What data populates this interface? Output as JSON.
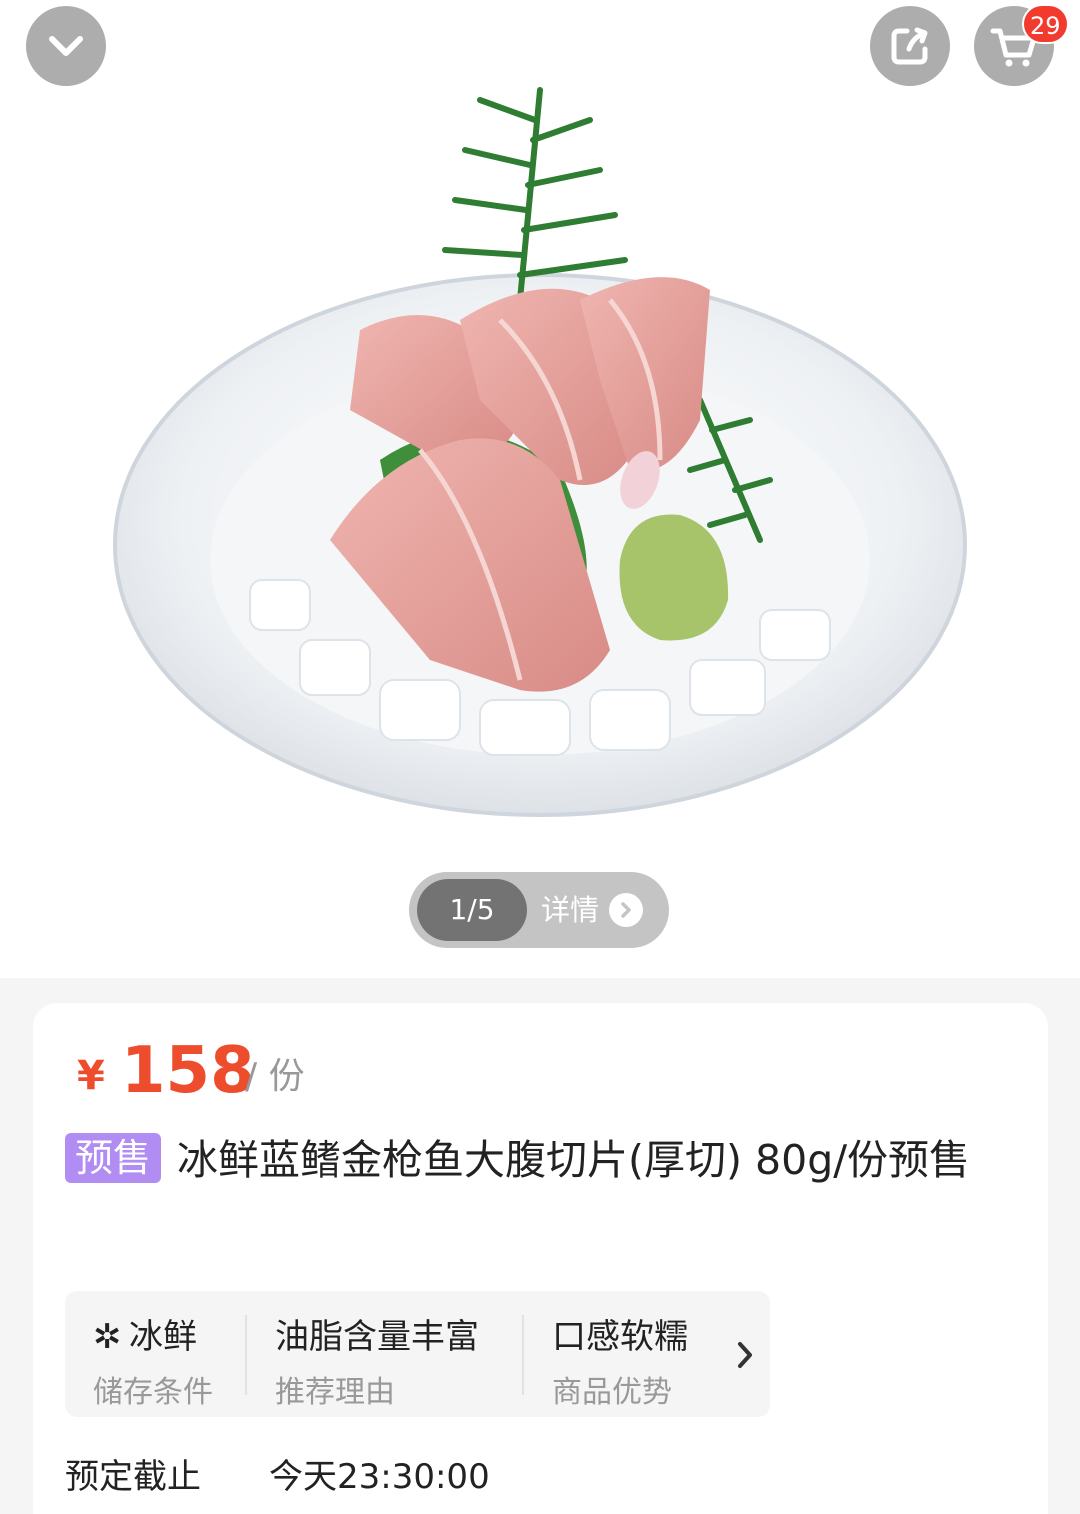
{
  "header": {
    "collapse_icon": "chevron-down-icon",
    "share_icon": "share-icon",
    "cart_icon": "cart-icon",
    "cart_count": "29"
  },
  "gallery": {
    "page_indicator": "1/5",
    "detail_label": "详情"
  },
  "product": {
    "currency": "¥",
    "price": "158",
    "unit": "/ 份",
    "tag": "预售",
    "title": "冰鲜蓝鳍金枪鱼大腹切片(厚切) 80g/份预售",
    "accent_color": "#ee4d2d",
    "tag_color": "#b08cf3",
    "attributes": [
      {
        "value": "冰鲜",
        "label": "储存条件",
        "icon": "snowflake-icon"
      },
      {
        "value": "油脂含量丰富",
        "label": "推荐理由"
      },
      {
        "value": "口感软糯",
        "label": "商品优势"
      }
    ],
    "deadline_label": "预定截止",
    "deadline_value": "今天23:30:00"
  }
}
